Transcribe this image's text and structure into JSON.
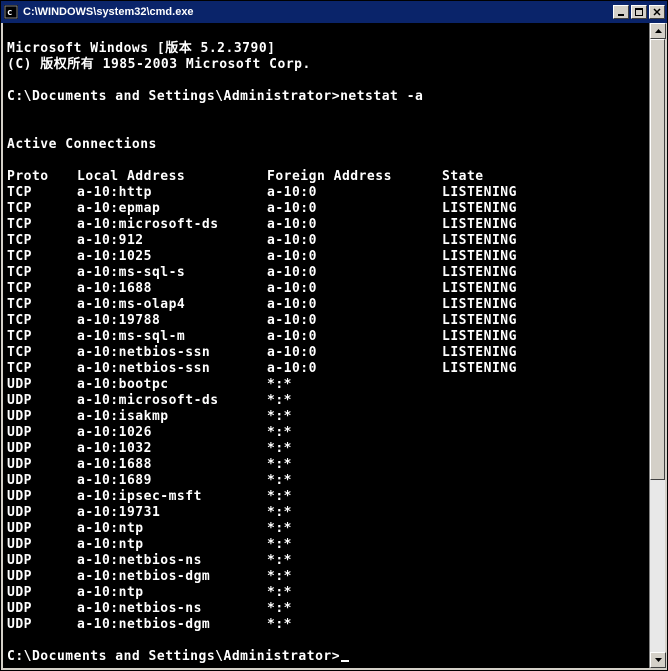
{
  "window": {
    "title": "C:\\WINDOWS\\system32\\cmd.exe"
  },
  "banner": {
    "line1": "Microsoft Windows [版本 5.2.3790]",
    "line2": "(C) 版权所有 1985-2003 Microsoft Corp."
  },
  "prompt": {
    "path": "C:\\Documents and Settings\\Administrator>",
    "command": "netstat -a"
  },
  "section_title": "Active Connections",
  "headers": {
    "proto": "Proto",
    "local": "Local Address",
    "foreign": "Foreign Address",
    "state": "State"
  },
  "rows": [
    {
      "proto": "TCP",
      "local": "a-10:http",
      "foreign": "a-10:0",
      "state": "LISTENING"
    },
    {
      "proto": "TCP",
      "local": "a-10:epmap",
      "foreign": "a-10:0",
      "state": "LISTENING"
    },
    {
      "proto": "TCP",
      "local": "a-10:microsoft-ds",
      "foreign": "a-10:0",
      "state": "LISTENING"
    },
    {
      "proto": "TCP",
      "local": "a-10:912",
      "foreign": "a-10:0",
      "state": "LISTENING"
    },
    {
      "proto": "TCP",
      "local": "a-10:1025",
      "foreign": "a-10:0",
      "state": "LISTENING"
    },
    {
      "proto": "TCP",
      "local": "a-10:ms-sql-s",
      "foreign": "a-10:0",
      "state": "LISTENING"
    },
    {
      "proto": "TCP",
      "local": "a-10:1688",
      "foreign": "a-10:0",
      "state": "LISTENING"
    },
    {
      "proto": "TCP",
      "local": "a-10:ms-olap4",
      "foreign": "a-10:0",
      "state": "LISTENING"
    },
    {
      "proto": "TCP",
      "local": "a-10:19788",
      "foreign": "a-10:0",
      "state": "LISTENING"
    },
    {
      "proto": "TCP",
      "local": "a-10:ms-sql-m",
      "foreign": "a-10:0",
      "state": "LISTENING"
    },
    {
      "proto": "TCP",
      "local": "a-10:netbios-ssn",
      "foreign": "a-10:0",
      "state": "LISTENING"
    },
    {
      "proto": "TCP",
      "local": "a-10:netbios-ssn",
      "foreign": "a-10:0",
      "state": "LISTENING"
    },
    {
      "proto": "UDP",
      "local": "a-10:bootpc",
      "foreign": "*:*",
      "state": ""
    },
    {
      "proto": "UDP",
      "local": "a-10:microsoft-ds",
      "foreign": "*:*",
      "state": ""
    },
    {
      "proto": "UDP",
      "local": "a-10:isakmp",
      "foreign": "*:*",
      "state": ""
    },
    {
      "proto": "UDP",
      "local": "a-10:1026",
      "foreign": "*:*",
      "state": ""
    },
    {
      "proto": "UDP",
      "local": "a-10:1032",
      "foreign": "*:*",
      "state": ""
    },
    {
      "proto": "UDP",
      "local": "a-10:1688",
      "foreign": "*:*",
      "state": ""
    },
    {
      "proto": "UDP",
      "local": "a-10:1689",
      "foreign": "*:*",
      "state": ""
    },
    {
      "proto": "UDP",
      "local": "a-10:ipsec-msft",
      "foreign": "*:*",
      "state": ""
    },
    {
      "proto": "UDP",
      "local": "a-10:19731",
      "foreign": "*:*",
      "state": ""
    },
    {
      "proto": "UDP",
      "local": "a-10:ntp",
      "foreign": "*:*",
      "state": ""
    },
    {
      "proto": "UDP",
      "local": "a-10:ntp",
      "foreign": "*:*",
      "state": ""
    },
    {
      "proto": "UDP",
      "local": "a-10:netbios-ns",
      "foreign": "*:*",
      "state": ""
    },
    {
      "proto": "UDP",
      "local": "a-10:netbios-dgm",
      "foreign": "*:*",
      "state": ""
    },
    {
      "proto": "UDP",
      "local": "a-10:ntp",
      "foreign": "*:*",
      "state": ""
    },
    {
      "proto": "UDP",
      "local": "a-10:netbios-ns",
      "foreign": "*:*",
      "state": ""
    },
    {
      "proto": "UDP",
      "local": "a-10:netbios-dgm",
      "foreign": "*:*",
      "state": ""
    }
  ],
  "prompt2": {
    "path": "C:\\Documents and Settings\\Administrator>"
  },
  "scrollbar": {
    "thumb_top_pct": 0,
    "thumb_height_pct": 72
  }
}
